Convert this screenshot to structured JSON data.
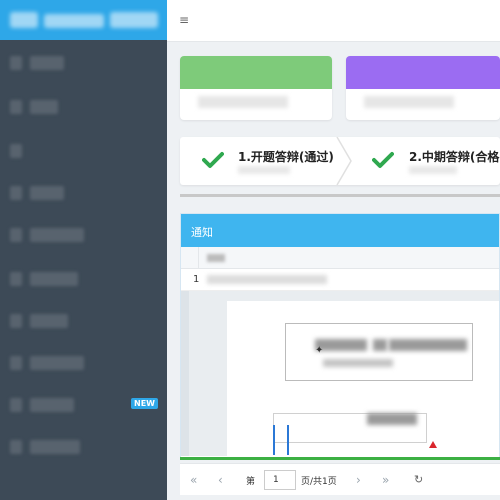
{
  "topbar": {
    "menu_icon": "hamburger-icon"
  },
  "sidebar": {
    "new_badge": "NEW",
    "item_count": 10,
    "colors": {
      "bg": "#3d4a57",
      "brand": "#2ea7e8"
    }
  },
  "stats": [
    {
      "color": "#7ecb7a"
    },
    {
      "color": "#9b6cf2"
    }
  ],
  "steps": [
    {
      "label": "1.开题答辩(通过)",
      "icon": "check-icon"
    },
    {
      "label": "2.中期答辩(合格",
      "icon": "check-icon"
    }
  ],
  "notice": {
    "title": "通知",
    "row_number": "1"
  },
  "pager": {
    "first_icon": "first-page-icon",
    "prev_icon": "prev-page-icon",
    "page_prefix": "第",
    "page_value": "1",
    "page_suffix": "页/共1页",
    "next_icon": "next-page-icon",
    "last_icon": "last-page-icon",
    "refresh_icon": "refresh-icon"
  }
}
